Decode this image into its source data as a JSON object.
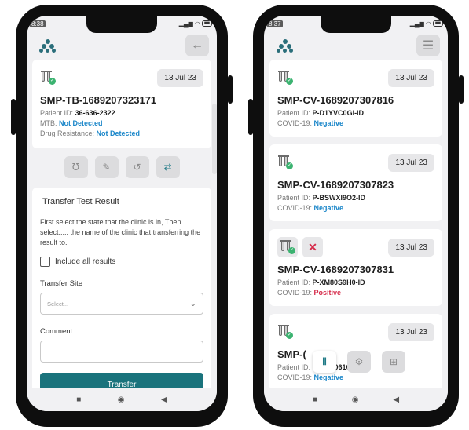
{
  "left": {
    "status_time": "8:38",
    "status_icons": "ᯤ ⊞",
    "card": {
      "date": "13 Jul 23",
      "sample_id": "SMP-TB-1689207323171",
      "patient_label": "Patient ID:",
      "patient_value": "36-636-2322",
      "mtb_label": "MTB:",
      "mtb_value": "Not Detected",
      "drug_label": "Drug Resistance:",
      "drug_value": "Not Detected"
    },
    "panel": {
      "title": "Transfer Test Result",
      "instruction": "First select the state that the clinic is in, Then select..... the name of the clinic that transferring the result to.",
      "include_all": "Include all results",
      "site_label": "Transfer Site",
      "site_placeholder": "Select...",
      "comment_label": "Comment",
      "button": "Transfer"
    }
  },
  "right": {
    "status_time": "8:37",
    "items": [
      {
        "date": "13 Jul 23",
        "sample_id": "SMP-CV-1689207307816",
        "patient_label": "Patient ID:",
        "patient_value": "P-D1YVC0GI-ID",
        "result_label": "COVID-19:",
        "result_value": "Negative"
      },
      {
        "date": "13 Jul 23",
        "sample_id": "SMP-CV-1689207307823",
        "patient_label": "Patient ID:",
        "patient_value": "P-BSWXI9O2-ID",
        "result_label": "COVID-19:",
        "result_value": "Negative"
      },
      {
        "date": "13 Jul 23",
        "sample_id": "SMP-CV-1689207307831",
        "patient_label": "Patient ID:",
        "patient_value": "P-XM80S9H0-ID",
        "result_label": "COVID-19:",
        "result_value": "Positive"
      },
      {
        "date": "13 Jul 23",
        "sample_id": "SMP-(",
        "patient_label": "Patient ID:",
        "patient_value": "P-XBC0610PJ-ID",
        "result_label": "COVID-19:",
        "result_value": "Negative"
      }
    ]
  },
  "colors": {
    "accent": "#1a737c",
    "negative": "#1a86c9",
    "positive": "#d62b4a",
    "ok_badge": "#3cb371"
  }
}
